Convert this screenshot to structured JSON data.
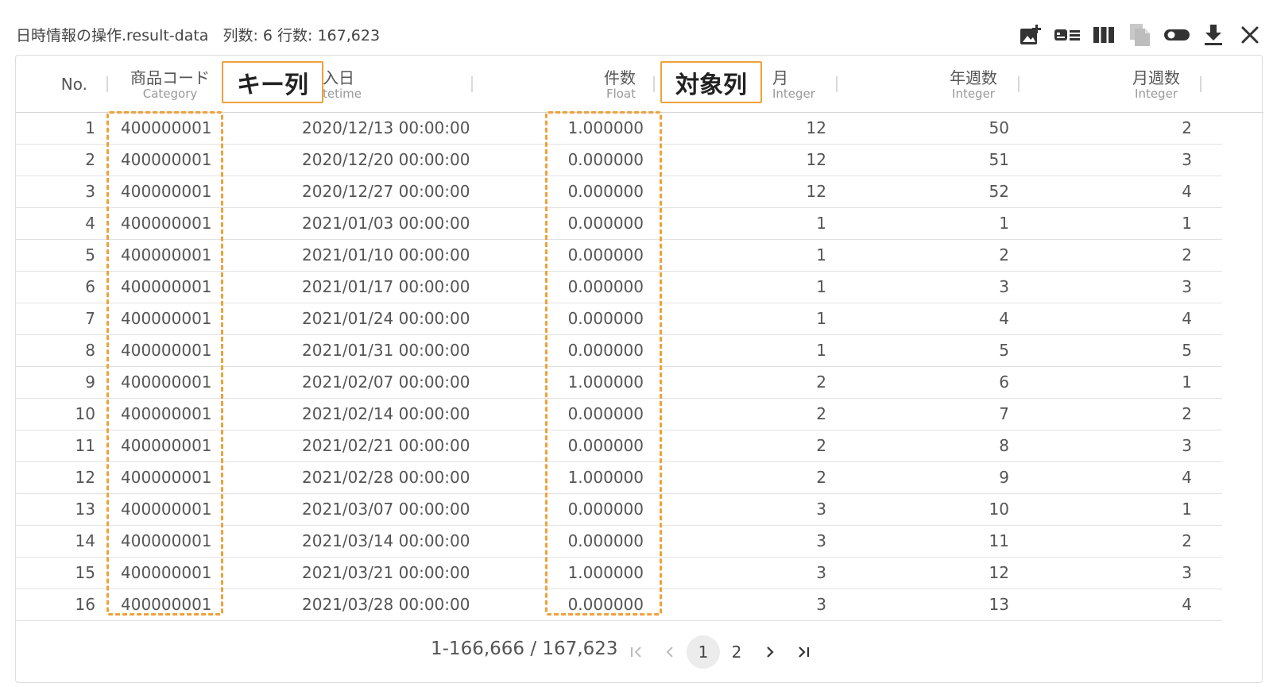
{
  "window": {
    "title": "日時情報の操作.result-data",
    "meta": "列数: 6 行数: 167,623"
  },
  "toolbar": {
    "icons": [
      "add-image-icon",
      "card-view-icon",
      "columns-icon",
      "copy-icon",
      "toggle-icon",
      "download-icon",
      "close-icon"
    ]
  },
  "table": {
    "columns": {
      "no": {
        "name": "No."
      },
      "code": {
        "name": "商品コード",
        "type": "Category"
      },
      "date": {
        "name": "購入日",
        "name_visible": "入日",
        "type": "Datetime",
        "type_visible": "tetime"
      },
      "count": {
        "name": "件数",
        "type": "Float"
      },
      "month": {
        "name": "月",
        "type": "Integer"
      },
      "year_week": {
        "name": "年週数",
        "type": "Integer"
      },
      "month_week": {
        "name": "月週数",
        "type": "Integer"
      }
    },
    "rows": [
      [
        "1",
        "400000001",
        "2020/12/13 00:00:00",
        "1.000000",
        "12",
        "50",
        "2"
      ],
      [
        "2",
        "400000001",
        "2020/12/20 00:00:00",
        "0.000000",
        "12",
        "51",
        "3"
      ],
      [
        "3",
        "400000001",
        "2020/12/27 00:00:00",
        "0.000000",
        "12",
        "52",
        "4"
      ],
      [
        "4",
        "400000001",
        "2021/01/03 00:00:00",
        "0.000000",
        "1",
        "1",
        "1"
      ],
      [
        "5",
        "400000001",
        "2021/01/10 00:00:00",
        "0.000000",
        "1",
        "2",
        "2"
      ],
      [
        "6",
        "400000001",
        "2021/01/17 00:00:00",
        "0.000000",
        "1",
        "3",
        "3"
      ],
      [
        "7",
        "400000001",
        "2021/01/24 00:00:00",
        "0.000000",
        "1",
        "4",
        "4"
      ],
      [
        "8",
        "400000001",
        "2021/01/31 00:00:00",
        "0.000000",
        "1",
        "5",
        "5"
      ],
      [
        "9",
        "400000001",
        "2021/02/07 00:00:00",
        "1.000000",
        "2",
        "6",
        "1"
      ],
      [
        "10",
        "400000001",
        "2021/02/14 00:00:00",
        "0.000000",
        "2",
        "7",
        "2"
      ],
      [
        "11",
        "400000001",
        "2021/02/21 00:00:00",
        "0.000000",
        "2",
        "8",
        "3"
      ],
      [
        "12",
        "400000001",
        "2021/02/28 00:00:00",
        "1.000000",
        "2",
        "9",
        "4"
      ],
      [
        "13",
        "400000001",
        "2021/03/07 00:00:00",
        "0.000000",
        "3",
        "10",
        "1"
      ],
      [
        "14",
        "400000001",
        "2021/03/14 00:00:00",
        "0.000000",
        "3",
        "11",
        "2"
      ],
      [
        "15",
        "400000001",
        "2021/03/21 00:00:00",
        "1.000000",
        "3",
        "12",
        "3"
      ],
      [
        "16",
        "400000001",
        "2021/03/28 00:00:00",
        "0.000000",
        "3",
        "13",
        "4"
      ]
    ]
  },
  "pagination": {
    "range": "1-166,666 / 167,623",
    "pages": [
      "1",
      "2"
    ],
    "current": "1"
  },
  "annotations": {
    "key_column": "キー列",
    "target_column": "対象列",
    "color": "#f0a13a"
  }
}
